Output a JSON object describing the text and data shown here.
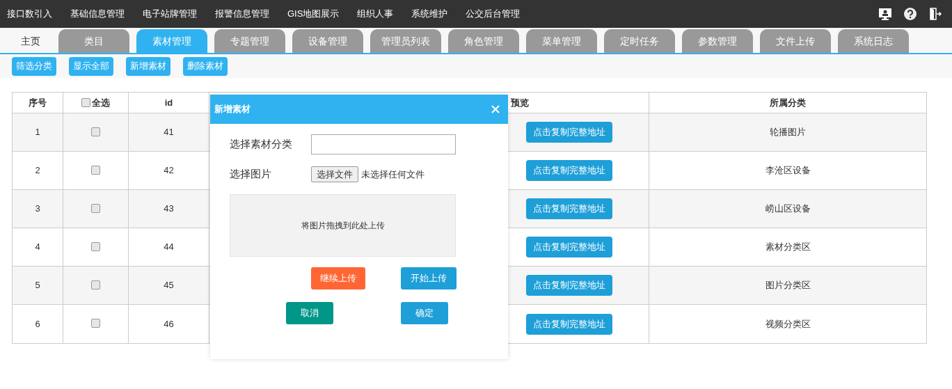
{
  "top_menu": [
    "接口数引入",
    "基础信息管理",
    "电子站牌管理",
    "报警信息管理",
    "GIS地图展示",
    "组织人事",
    "系统维护",
    "公交后台管理"
  ],
  "tabs": [
    {
      "label": "主页",
      "kind": "plain",
      "selected": false
    },
    {
      "label": "类目",
      "kind": "tab",
      "selected": false
    },
    {
      "label": "素材管理",
      "kind": "tab",
      "selected": true
    },
    {
      "label": "专题管理",
      "kind": "tab",
      "selected": false
    },
    {
      "label": "设备管理",
      "kind": "tab",
      "selected": false
    },
    {
      "label": "管理员列表",
      "kind": "tab",
      "selected": false
    },
    {
      "label": "角色管理",
      "kind": "tab",
      "selected": false
    },
    {
      "label": "菜单管理",
      "kind": "tab",
      "selected": false
    },
    {
      "label": "定时任务",
      "kind": "tab",
      "selected": false
    },
    {
      "label": "参数管理",
      "kind": "tab",
      "selected": false
    },
    {
      "label": "文件上传",
      "kind": "tab",
      "selected": false
    },
    {
      "label": "系统日志",
      "kind": "tab",
      "selected": false
    }
  ],
  "toolbar": [
    "筛选分类",
    "显示全部",
    "新增素材",
    "删除素材"
  ],
  "table": {
    "columns": [
      "序号",
      "全选",
      "id",
      "预览",
      "所属分类"
    ],
    "select_all_checked": false,
    "rows": [
      {
        "no": "1",
        "checked": false,
        "id": "41",
        "action": "点击复制完整地址",
        "category": "轮播图片"
      },
      {
        "no": "2",
        "checked": false,
        "id": "42",
        "action": "点击复制完整地址",
        "category": "李沧区设备"
      },
      {
        "no": "3",
        "checked": false,
        "id": "43",
        "action": "点击复制完整地址",
        "category": "崂山区设备"
      },
      {
        "no": "4",
        "checked": false,
        "id": "44",
        "action": "点击复制完整地址",
        "category": "素材分类区"
      },
      {
        "no": "5",
        "checked": false,
        "id": "45",
        "action": "点击复制完整地址",
        "category": "图片分类区"
      },
      {
        "no": "6",
        "checked": false,
        "id": "46",
        "action": "点击复制完整地址",
        "category": "视频分类区"
      }
    ]
  },
  "dialog": {
    "title": "新增素材",
    "category_label": "选择素材分类",
    "image_label": "选择图片",
    "file_button": "选择文件",
    "file_status": "未选择任何文件",
    "drop_zone": "将图片拖拽到此处上传",
    "buttons": [
      {
        "label": "继续上传",
        "kind": "warn"
      },
      {
        "label": "开始上传",
        "kind": "primary"
      },
      {
        "label": "取消",
        "kind": "teal"
      },
      {
        "label": "确定",
        "kind": "primary"
      }
    ]
  }
}
